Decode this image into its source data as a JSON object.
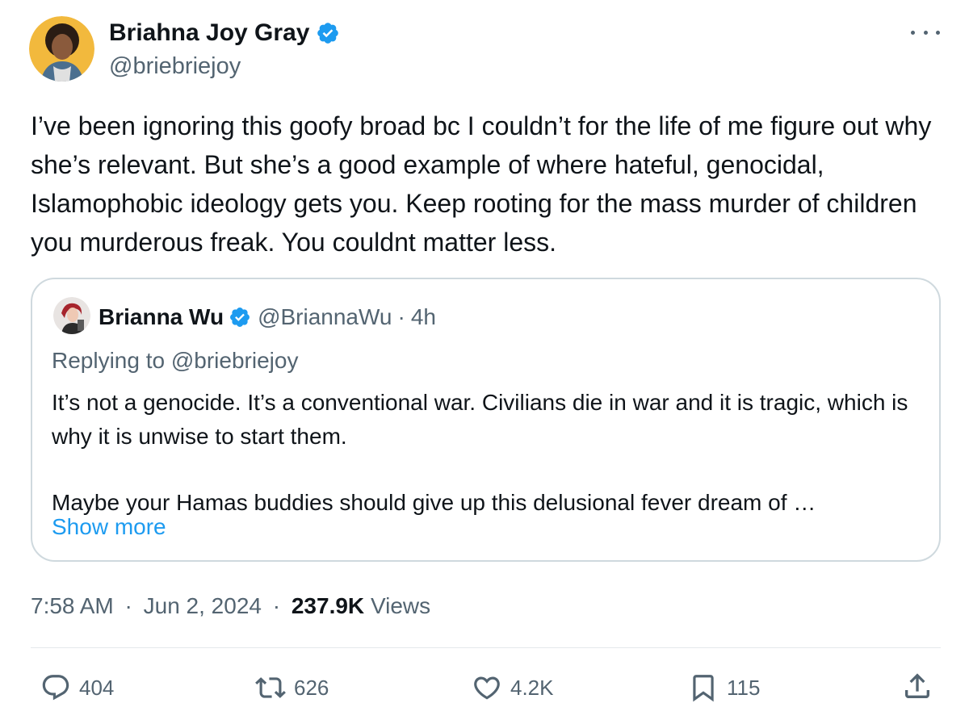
{
  "author": {
    "name": "Briahna Joy Gray",
    "handle": "@briebriejoy"
  },
  "tweet_text": "I’ve been ignoring this goofy broad bc I couldn’t for the life of me figure out why she’s relevant. But she’s a good example of where hateful, genocidal, Islamophobic ideology gets you. Keep rooting for the mass murder of children you murderous freak. You couldnt matter less.",
  "quote": {
    "name": "Brianna Wu",
    "handle": "@BriannaWu",
    "separator": "·",
    "age": "4h",
    "replying_to": "Replying to @briebriejoy",
    "paragraph_1": "It’s not a genocide. It’s a conventional war. Civilians die in war and it is tragic, which is why it is unwise to start them.",
    "paragraph_2": "Maybe your Hamas buddies should give up this delusional fever dream of …",
    "show_more": "Show more"
  },
  "meta": {
    "time": "7:58 AM",
    "separator": "·",
    "date": "Jun 2, 2024",
    "views_count": "237.9K",
    "views_label": "Views"
  },
  "actions": {
    "replies": "404",
    "reposts": "626",
    "likes": "4.2K",
    "bookmarks": "115"
  },
  "colors": {
    "accent": "#1d9bf0",
    "secondary_text": "#536471",
    "primary_text": "#0f1419",
    "border": "#cfd9de"
  },
  "icons": [
    "verified-badge-icon",
    "more-icon",
    "reply-icon",
    "repost-icon",
    "like-icon",
    "bookmark-icon",
    "share-icon"
  ]
}
